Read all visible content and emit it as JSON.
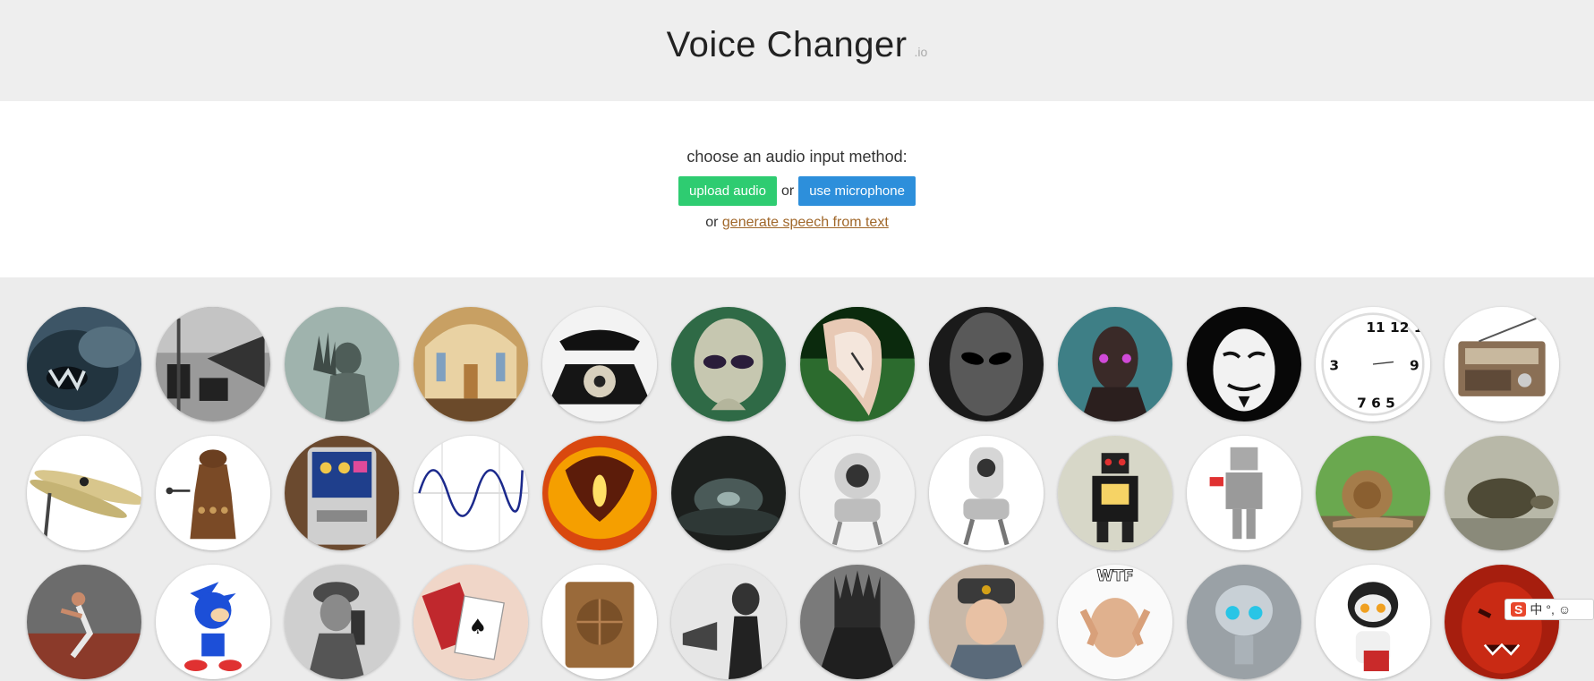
{
  "header": {
    "title": "Voice Changer",
    "suffix": ".io"
  },
  "input": {
    "prompt": "choose an audio input method:",
    "upload_label": "upload audio",
    "or_label": "or",
    "mic_label": "use microphone",
    "tts_prefix": "or",
    "tts_link": "generate speech from text"
  },
  "ime": {
    "logo": "S",
    "lang": "中",
    "punct": "°,",
    "emoji": "☺"
  },
  "colors": {
    "upload_button": "#2ecc71",
    "mic_button": "#2d8fdb",
    "link": "#a0672a",
    "background": "#ececec"
  },
  "voices": [
    "monster-icon",
    "megaphone-icon",
    "ghost-icon",
    "church-icon",
    "telephone-icon",
    "alien-icon",
    "melting-clock-icon",
    "grey-alien-icon",
    "cyborg-icon",
    "anonymous-mask-icon",
    "mirror-clock-icon",
    "radio-icon",
    "cymbal-icon",
    "dalek-icon",
    "guitar-pedal-icon",
    "sine-wave-icon",
    "balrog-icon",
    "cave-icon",
    "robot-eye-icon",
    "robot-eye-2-icon",
    "toy-robot-icon",
    "lego-robot-icon",
    "snail-icon",
    "tortoise-icon",
    "sprinter-icon",
    "sonic-icon",
    "soldier-radio-icon",
    "playing-cards-icon",
    "speaker-box-icon",
    "gramophone-icon",
    "dark-lord-icon",
    "russian-soldier-icon",
    "wtf-meme-icon",
    "gir-robot-icon",
    "kirobo-robot-icon",
    "demon-icon"
  ]
}
